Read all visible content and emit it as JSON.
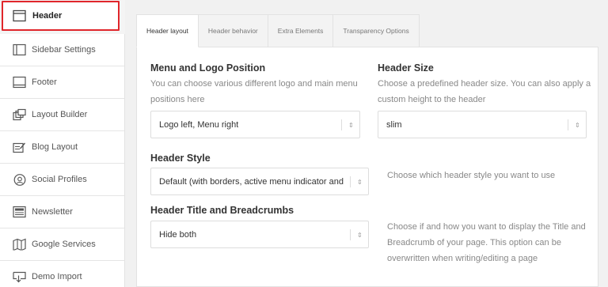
{
  "sidebar": {
    "items": [
      {
        "label": "Header",
        "icon": "window-icon"
      },
      {
        "label": "Sidebar Settings",
        "icon": "sidebar-icon"
      },
      {
        "label": "Footer",
        "icon": "footer-icon"
      },
      {
        "label": "Layout Builder",
        "icon": "layout-builder-icon"
      },
      {
        "label": "Blog Layout",
        "icon": "edit-icon"
      },
      {
        "label": "Social Profiles",
        "icon": "at-sign-icon"
      },
      {
        "label": "Newsletter",
        "icon": "newsletter-icon"
      },
      {
        "label": "Google Services",
        "icon": "map-icon"
      },
      {
        "label": "Demo Import",
        "icon": "import-icon"
      }
    ]
  },
  "tabs": [
    "Header layout",
    "Header behavior",
    "Extra Elements",
    "Transparency Options"
  ],
  "main": {
    "menu_logo": {
      "title": "Menu and Logo Position",
      "desc": "You can choose various different logo and main menu positions here",
      "value": "Logo left, Menu right"
    },
    "header_size": {
      "title": "Header Size",
      "desc": "Choose a predefined header size. You can also apply a custom height to the header",
      "value": "slim"
    },
    "header_style": {
      "title": "Header Style",
      "value": "Default (with borders, active menu indicator and",
      "desc": "Choose which header style you want to use"
    },
    "breadcrumbs": {
      "title": "Header Title and Breadcrumbs",
      "value": "Hide both",
      "desc": "Choose if and how you want to display the Title and Breadcrumb of your page. This option can be overwritten when writing/editing a page"
    }
  }
}
